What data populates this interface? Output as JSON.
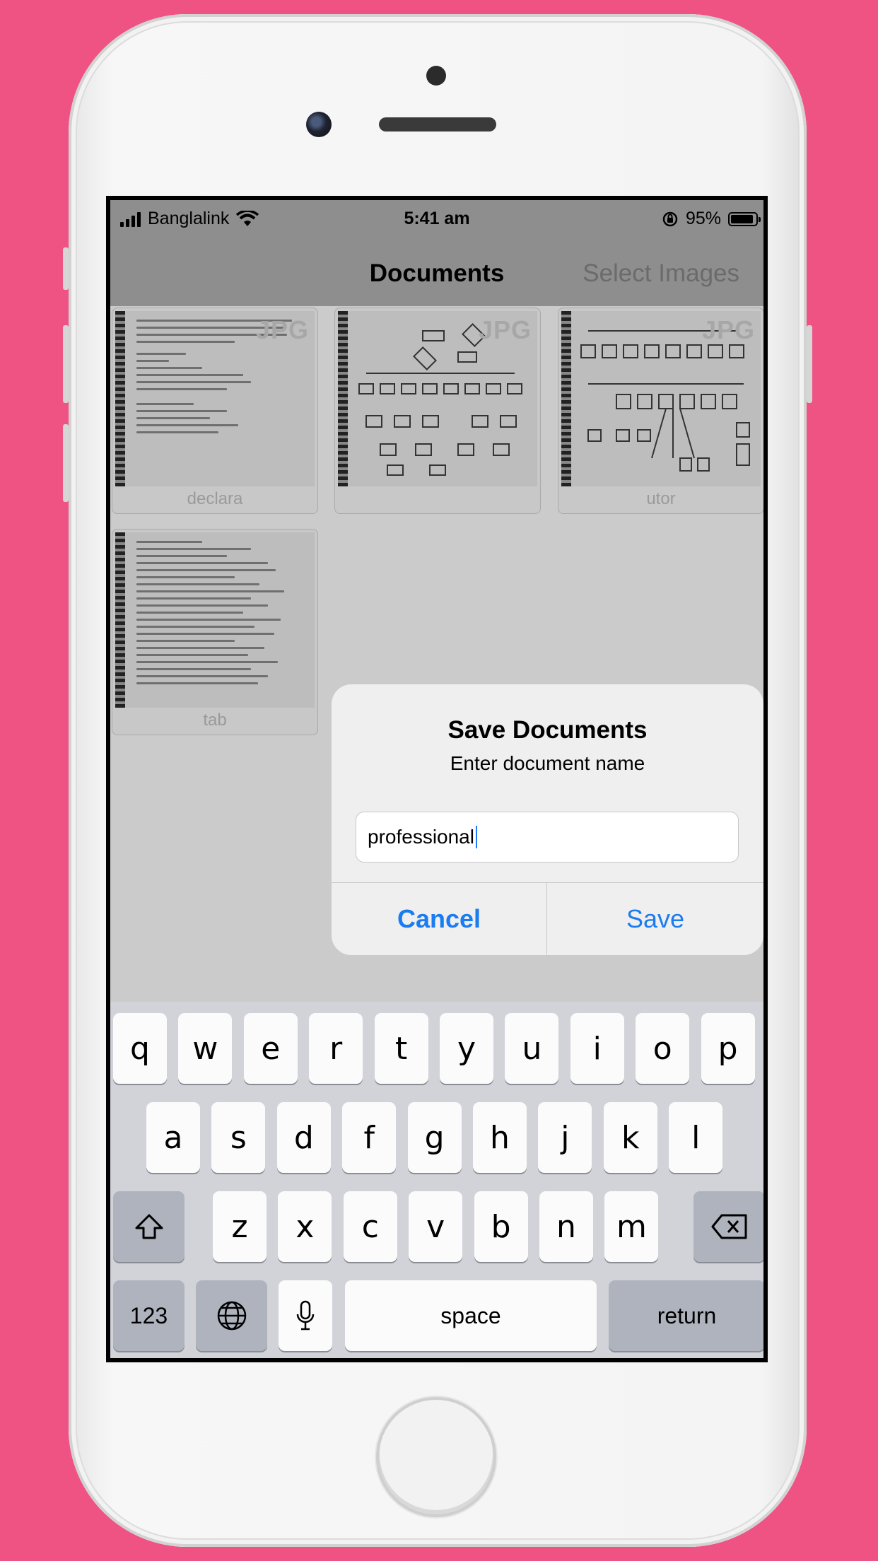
{
  "status_bar": {
    "carrier": "Banglalink",
    "time": "5:41 am",
    "battery": "95%"
  },
  "nav": {
    "title": "Documents",
    "right_button": "Select Images"
  },
  "documents": [
    {
      "badge": "JPG",
      "name": "declara"
    },
    {
      "badge": "JPG",
      "name": ""
    },
    {
      "badge": "JPG",
      "name": "utor"
    },
    {
      "badge": "",
      "name": "tab"
    }
  ],
  "dialog": {
    "title": "Save Documents",
    "message": "Enter document name",
    "input_value": "professional",
    "cancel_label": "Cancel",
    "save_label": "Save"
  },
  "keyboard": {
    "row1": [
      "q",
      "w",
      "e",
      "r",
      "t",
      "y",
      "u",
      "i",
      "o",
      "p"
    ],
    "row2": [
      "a",
      "s",
      "d",
      "f",
      "g",
      "h",
      "j",
      "k",
      "l"
    ],
    "row3": [
      "z",
      "x",
      "c",
      "v",
      "b",
      "n",
      "m"
    ],
    "numbers_label": "123",
    "space_label": "space",
    "return_label": "return",
    "icons": {
      "shift": "shift-icon",
      "delete": "backspace-icon",
      "globe": "globe-icon",
      "mic": "microphone-icon"
    }
  },
  "colors": {
    "background": "#ef5384",
    "accent": "#1a7cf0"
  }
}
